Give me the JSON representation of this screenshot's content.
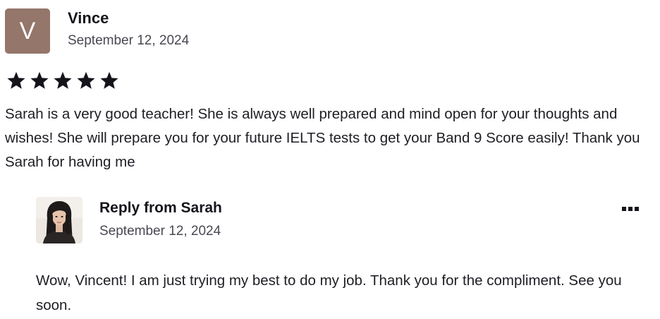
{
  "review": {
    "avatar_letter": "V",
    "avatar_color": "#94766a",
    "author": "Vince",
    "date": "September 12, 2024",
    "rating": 5,
    "rating_max": 5,
    "text": "Sarah is a very good teacher! She is always well prepared and mind open for your thoughts and wishes! She will prepare you for your future IELTS tests to get your Band 9 Score easily! Thank you Sarah for having me"
  },
  "reply": {
    "title": "Reply from Sarah",
    "date": "September 12, 2024",
    "more_icon": "more-options-icon",
    "text": "Wow, Vincent! I am just trying my best to do my job. Thank you for the compliment. See you soon."
  }
}
